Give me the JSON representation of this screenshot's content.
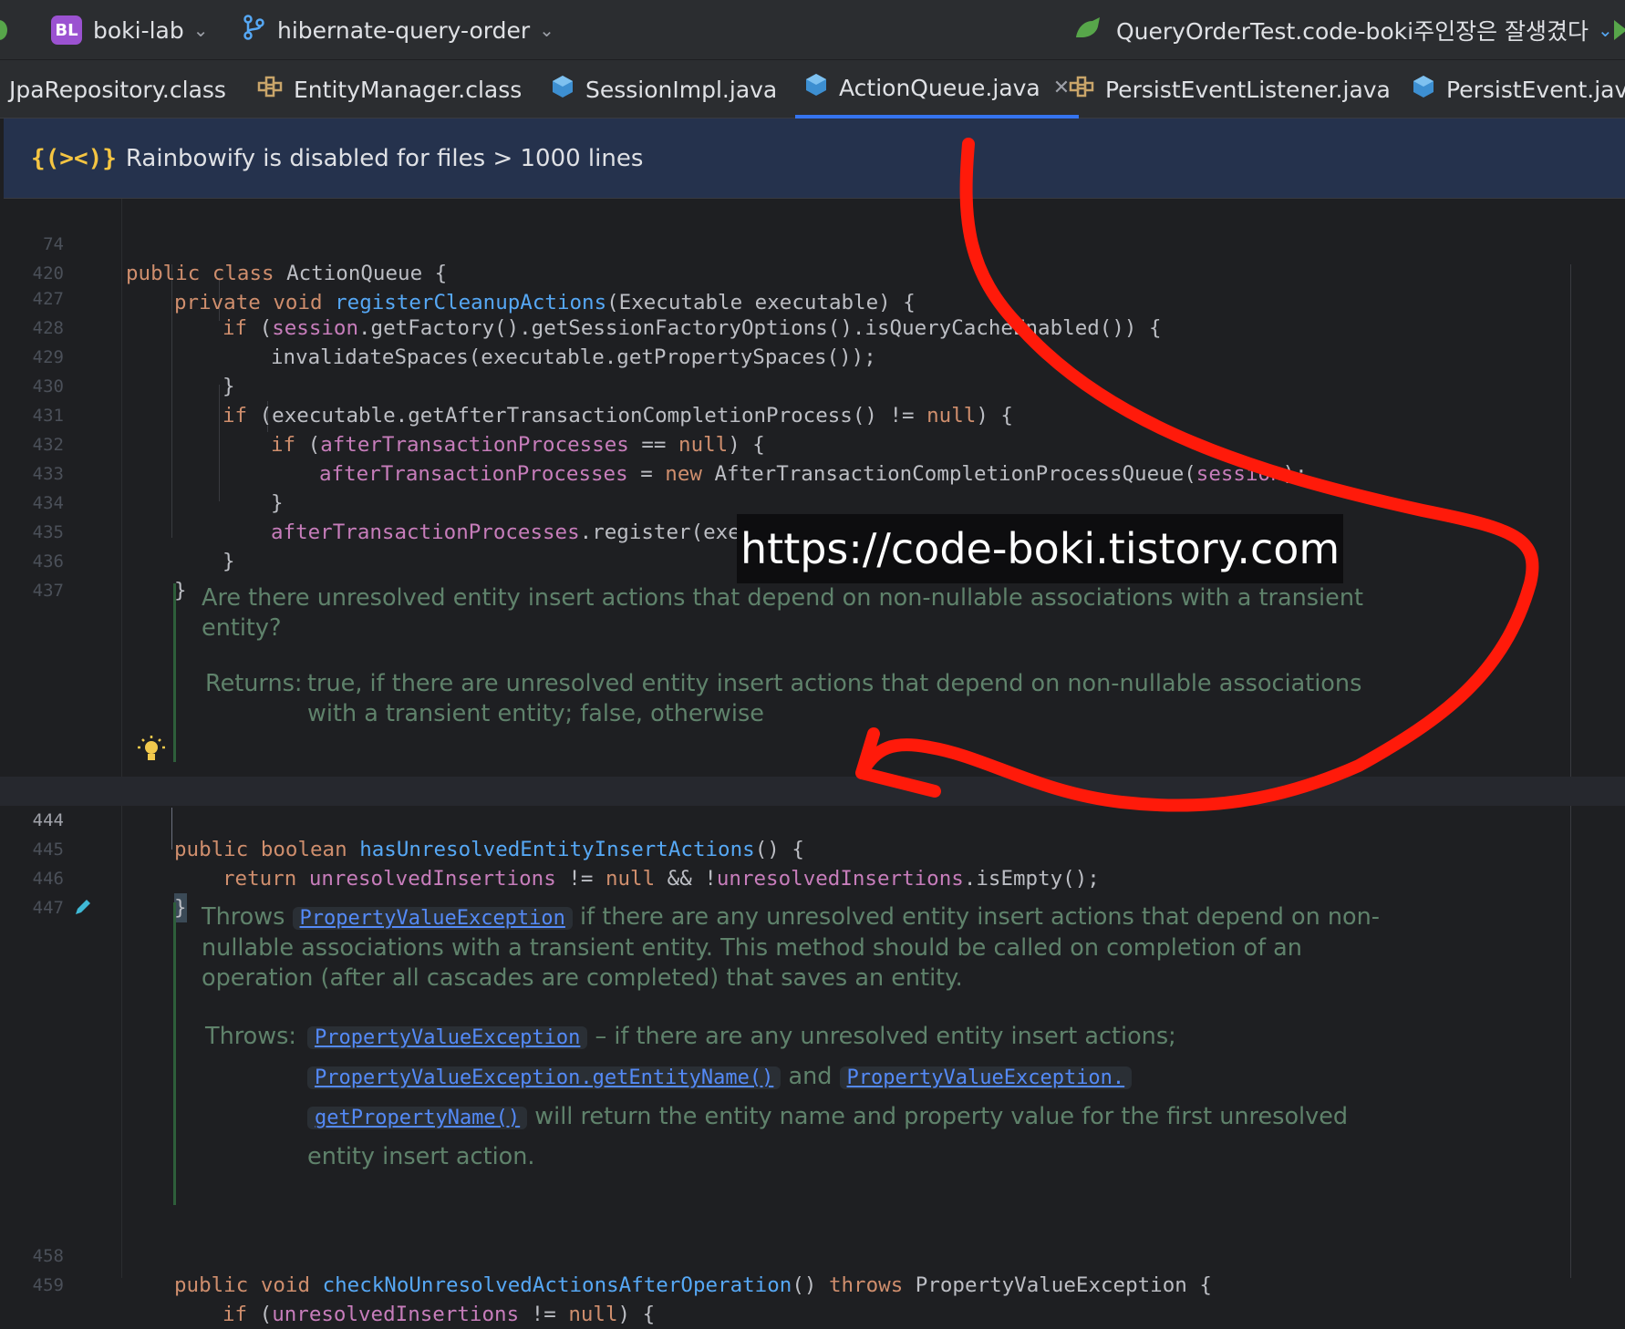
{
  "toolbar": {
    "project_badge": "BL",
    "project_name": "boki-lab",
    "branch_name": "hibernate-query-order",
    "run_config": "QueryOrderTest.code-boki주인장은 잘생겼다"
  },
  "tabs": [
    {
      "label": "JpaRepository.class",
      "icon": "interface-class-icon"
    },
    {
      "label": "EntityManager.class",
      "icon": "interface-class-icon"
    },
    {
      "label": "SessionImpl.java",
      "icon": "java-class-icon"
    },
    {
      "label": "ActionQueue.java",
      "icon": "java-class-icon",
      "active": true
    },
    {
      "label": "PersistEventListener.java",
      "icon": "interface-class-icon"
    },
    {
      "label": "PersistEvent.java",
      "icon": "java-class-icon"
    }
  ],
  "banner": {
    "icon": "{(><)}",
    "text": "Rainbowify is disabled for files > 1000 lines"
  },
  "line_numbers": {
    "l74": "74",
    "l420": "420",
    "l427": "427",
    "l428": "428",
    "l429": "429",
    "l430": "430",
    "l431": "431",
    "l432": "432",
    "l433": "433",
    "l434": "434",
    "l435": "435",
    "l436": "436",
    "l437": "437",
    "l444": "444",
    "l445": "445",
    "l446": "446",
    "l447": "447",
    "l458": "458",
    "l459": "459"
  },
  "code": {
    "l74": {
      "kw": "public class",
      "name": "ActionQueue",
      "rest": "{"
    },
    "l420": {
      "kw": "private void",
      "fn": "registerCleanupActions",
      "rest": "(Executable executable) {"
    },
    "l427": {
      "kw": "if",
      "open": "(",
      "fld": "session",
      "rest": ".getFactory().getSessionFactoryOptions().isQueryCacheEnabled()) {"
    },
    "l428": {
      "rest": "invalidateSpaces(executable.getPropertySpaces());"
    },
    "l429": {
      "rest": "}"
    },
    "l430": {
      "kw": "if",
      "rest": "(executable.getAfterTransactionCompletionProcess() != ",
      "kw2": "null",
      "rest2": ") {"
    },
    "l431": {
      "kw": "if",
      "open": "(",
      "fld": "afterTransactionProcesses",
      "rest": " == ",
      "kw2": "null",
      "rest2": ") {"
    },
    "l432": {
      "fld": "afterTransactionProcesses",
      "rest": " = ",
      "kw": "new",
      "rest2": " AfterTransactionCompletionProcessQueue(",
      "fld2": "session",
      "rest3": ");"
    },
    "l433": {
      "rest": "}"
    },
    "l434": {
      "fld": "afterTransactionProcesses",
      "rest": ".register(executable.getAfterTransactionCompletionProcess());"
    },
    "l435": {
      "rest": "}"
    },
    "l436": {
      "rest": "}"
    },
    "l444": {
      "kw": "public boolean",
      "fn": "hasUnresolvedEntityInsertActions",
      "rest": "() {"
    },
    "l445": {
      "kw": "return",
      "fld": "unresolvedInsertions",
      "rest": " != ",
      "kw2": "null",
      "rest2": " && !",
      "fld2": "unresolvedInsertions",
      "rest3": ".isEmpty();"
    },
    "l446": {
      "rest": "}"
    },
    "l458": {
      "kw": "public void",
      "fn": "checkNoUnresolvedActionsAfterOperation",
      "rest": "() ",
      "kw2": "throws",
      "rest2": " PropertyValueException {"
    },
    "l459": {
      "kw": "if",
      "open": "(",
      "fld": "unresolvedInsertions",
      "rest": " != ",
      "kw2": "null",
      "rest2": ") {"
    }
  },
  "doc1": {
    "text": "Are there unresolved entity insert actions that depend on non-nullable associations with a transient entity?",
    "returns_label": "Returns:",
    "returns_text": "true, if there are unresolved entity insert actions that depend on non-nullable associations with a transient entity; false, otherwise"
  },
  "doc2": {
    "throws_word": "Throws",
    "link1": "PropertyValueException",
    "text1": "if there are any unresolved entity insert actions that depend on non-nullable associations with a transient entity. This method should be called on completion of an operation (after all cascades are completed) that saves an entity.",
    "throws_label": "Throws:",
    "link2": "PropertyValueException",
    "text2": "– if there are any unresolved entity insert actions;",
    "link3": "PropertyValueException.getEntityName()",
    "and": "and",
    "link4": "PropertyValueException.",
    "link5": "getPropertyName()",
    "text3": "will return the entity name and property value for the first unresolved entity insert action."
  },
  "watermark": "https://code-boki.tistory.com",
  "colors": {
    "arrow": "#ff1a0a",
    "keyword": "#cf8e6d",
    "function": "#56a8f5",
    "field": "#c77dbb",
    "doc": "#5f826b",
    "tab_underline": "#3574f0"
  }
}
